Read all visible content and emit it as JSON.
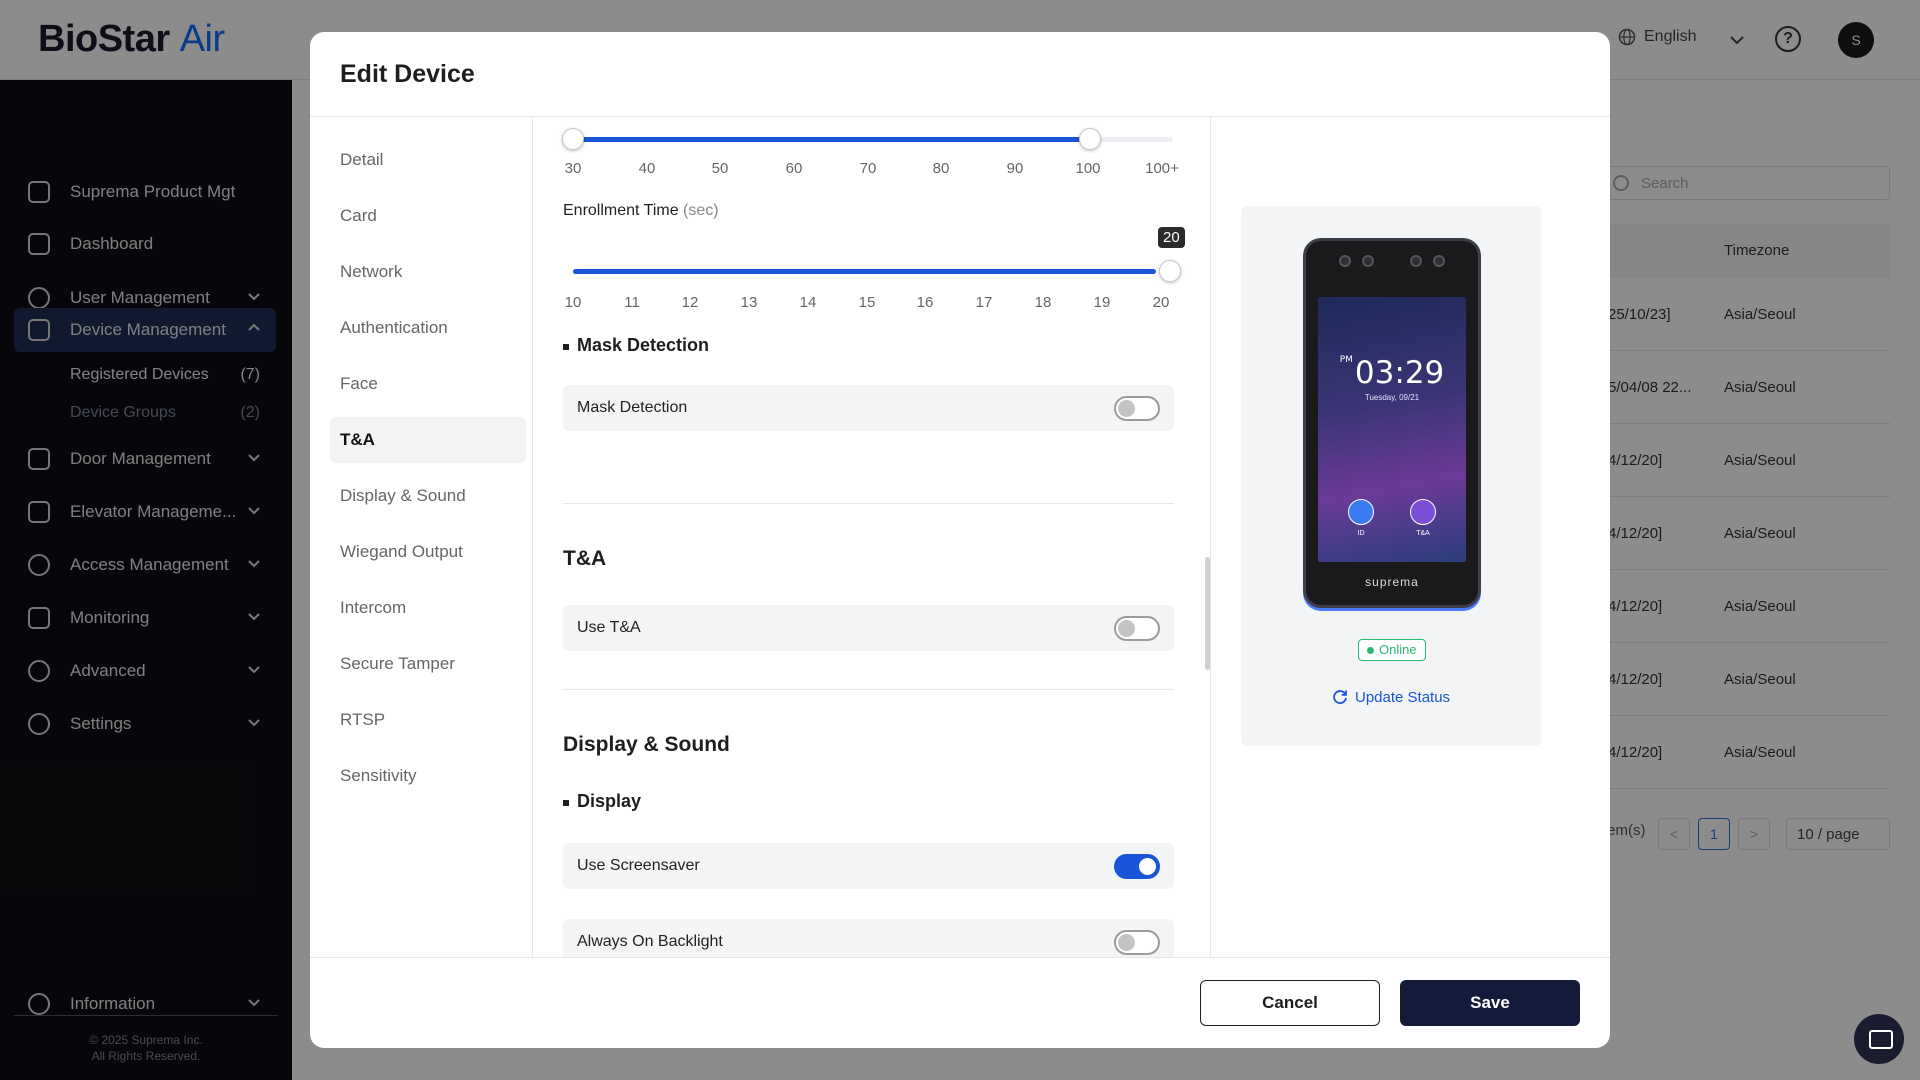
{
  "app": {
    "logo_main": "BioStar ",
    "logo_accent": "Air",
    "language": "English",
    "help": "?",
    "avatar_initial": "S"
  },
  "sidebar": {
    "items": [
      {
        "label": "Suprema Product Mgt"
      },
      {
        "label": "Dashboard"
      },
      {
        "label": "User Management"
      },
      {
        "label": "Device Management"
      },
      {
        "label": "Door Management"
      },
      {
        "label": "Elevator Manageme..."
      },
      {
        "label": "Access Management"
      },
      {
        "label": "Monitoring"
      },
      {
        "label": "Advanced"
      },
      {
        "label": "Settings"
      }
    ],
    "sub_items": [
      {
        "label": "Registered Devices",
        "count": "(7)"
      },
      {
        "label": "Device Groups",
        "count": "(2)"
      }
    ],
    "information": "Information",
    "copyright_1": "© 2025 Suprema Inc.",
    "copyright_2": "All Rights Reserved."
  },
  "background_table": {
    "search_placeholder": "Search",
    "col_timezone": "Timezone",
    "rows": [
      {
        "date": "25/10/23]",
        "tz": "Asia/Seoul"
      },
      {
        "date": "5/04/08 22...",
        "tz": "Asia/Seoul"
      },
      {
        "date": "4/12/20]",
        "tz": "Asia/Seoul"
      },
      {
        "date": "4/12/20]",
        "tz": "Asia/Seoul"
      },
      {
        "date": "4/12/20]",
        "tz": "Asia/Seoul"
      },
      {
        "date": "4/12/20]",
        "tz": "Asia/Seoul"
      },
      {
        "date": "4/12/20]",
        "tz": "Asia/Seoul"
      }
    ],
    "items_label": "tem(s)",
    "prev": "<",
    "page": "1",
    "next": ">",
    "page_size": "10 / page"
  },
  "modal": {
    "title": "Edit Device",
    "tabs": [
      {
        "label": "Detail"
      },
      {
        "label": "Card"
      },
      {
        "label": "Network"
      },
      {
        "label": "Authentication"
      },
      {
        "label": "Face"
      },
      {
        "label": "T&A"
      },
      {
        "label": "Display & Sound"
      },
      {
        "label": "Wiegand Output"
      },
      {
        "label": "Intercom"
      },
      {
        "label": "Secure Tamper"
      },
      {
        "label": "RTSP"
      },
      {
        "label": "Sensitivity"
      }
    ],
    "active_tab": "T&A",
    "range_slider": {
      "ticks": [
        "30",
        "40",
        "50",
        "60",
        "70",
        "80",
        "90",
        "100",
        "100+"
      ],
      "low": "30",
      "high": "100"
    },
    "enrollment_time": {
      "label": "Enrollment Time",
      "unit": "(sec)",
      "ticks": [
        "10",
        "11",
        "12",
        "13",
        "14",
        "15",
        "16",
        "17",
        "18",
        "19",
        "20"
      ],
      "value": "20"
    },
    "mask_section": {
      "heading": "Mask Detection",
      "option_label": "Mask Detection",
      "enabled": false
    },
    "ta_section": {
      "heading": "T&A",
      "option_label": "Use T&A",
      "enabled": false
    },
    "display_sound": {
      "heading": "Display & Sound",
      "subheading": "Display",
      "options": [
        {
          "label": "Use Screensaver",
          "enabled": true
        },
        {
          "label": "Always On Backlight",
          "enabled": false
        }
      ]
    },
    "device_preview": {
      "time_ampm": "PM",
      "time": "03:29",
      "date": "Tuesday, 09/21",
      "btn_id": "ID",
      "btn_ta": "T&A",
      "brand": "suprema",
      "status": "Online",
      "update_link": "Update Status"
    },
    "buttons": {
      "cancel": "Cancel",
      "save": "Save"
    }
  },
  "colors": {
    "accent": "#1a54d9",
    "sidebar_bg": "#0e0e14",
    "online": "#2bb673",
    "save_bg": "#131a3a"
  }
}
